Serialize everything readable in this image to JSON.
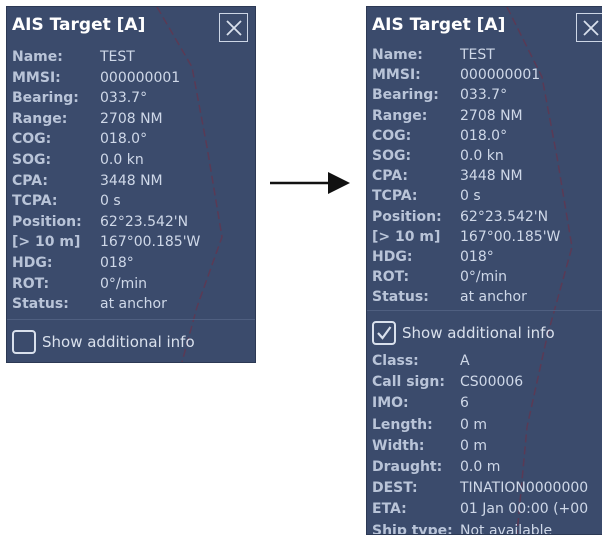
{
  "left_panel": {
    "title": "AIS Target [A]",
    "fields": [
      {
        "label": "Name:",
        "value": "TEST"
      },
      {
        "label": "MMSI:",
        "value": "000000001"
      },
      {
        "label": "Bearing:",
        "value": "033.7°"
      },
      {
        "label": "Range:",
        "value": "2708 NM"
      },
      {
        "label": "COG:",
        "value": "018.0°"
      },
      {
        "label": "SOG:",
        "value": "0.0 kn"
      },
      {
        "label": "CPA:",
        "value": "3448 NM"
      },
      {
        "label": "TCPA:",
        "value": "0 s"
      },
      {
        "label": "Position:",
        "value": "62°23.542'N"
      },
      {
        "label": "[> 10 m]",
        "value": "167°00.185'W"
      },
      {
        "label": "HDG:",
        "value": "018°"
      },
      {
        "label": "ROT:",
        "value": "0°/min"
      },
      {
        "label": "Status:",
        "value": "at anchor"
      }
    ],
    "show_additional": {
      "label": "Show additional info",
      "checked": false
    }
  },
  "right_panel": {
    "title": "AIS Target [A]",
    "fields": [
      {
        "label": "Name:",
        "value": "TEST"
      },
      {
        "label": "MMSI:",
        "value": "000000001"
      },
      {
        "label": "Bearing:",
        "value": "033.7°"
      },
      {
        "label": "Range:",
        "value": "2708 NM"
      },
      {
        "label": "COG:",
        "value": "018.0°"
      },
      {
        "label": "SOG:",
        "value": "0.0 kn"
      },
      {
        "label": "CPA:",
        "value": "3448 NM"
      },
      {
        "label": "TCPA:",
        "value": "0 s"
      },
      {
        "label": "Position:",
        "value": "62°23.542'N"
      },
      {
        "label": "[> 10 m]",
        "value": "167°00.185'W"
      },
      {
        "label": "HDG:",
        "value": "018°"
      },
      {
        "label": "ROT:",
        "value": "0°/min"
      },
      {
        "label": "Status:",
        "value": "at anchor"
      }
    ],
    "show_additional": {
      "label": "Show additional info",
      "checked": true
    },
    "additional_fields": [
      {
        "label": "Class:",
        "value": "A"
      },
      {
        "label": "Call sign:",
        "value": "CS00006"
      },
      {
        "label": "IMO:",
        "value": "6"
      },
      {
        "label": "Length:",
        "value": "0 m"
      },
      {
        "label": "Width:",
        "value": "0 m"
      },
      {
        "label": "Draught:",
        "value": "0.0 m"
      },
      {
        "label": "DEST:",
        "value": "TINATION0000000"
      },
      {
        "label": "ETA:",
        "value": "01 Jan 00:00 (+00"
      },
      {
        "label": "Ship type:",
        "value": "Not available"
      }
    ]
  },
  "colors": {
    "panel_bg": "#3b4b6c",
    "label": "#b9c4d8",
    "value": "#cfd8e8",
    "title": "#ffffff"
  }
}
